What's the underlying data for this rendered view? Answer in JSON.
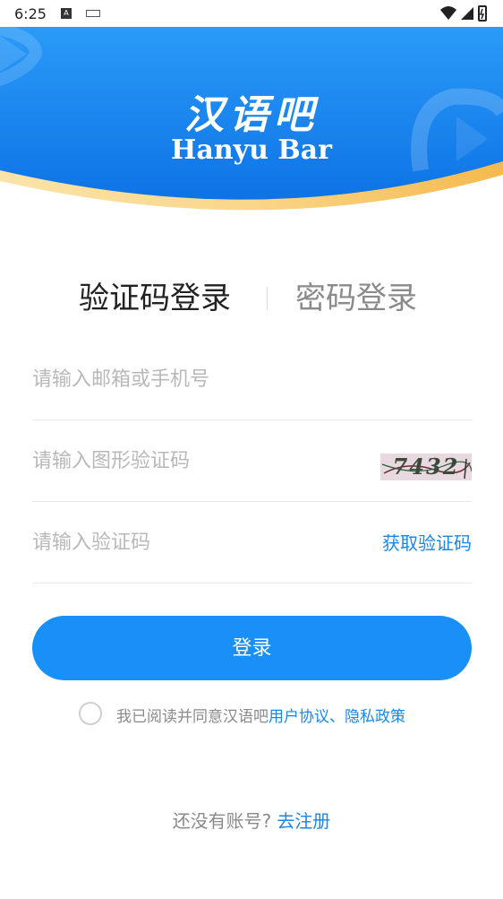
{
  "status_bar": {
    "time": "6:25"
  },
  "header": {
    "brand_cn": "汉语吧",
    "brand_en": "Hanyu Bar",
    "colors": {
      "blue_top": "#1e8ff5",
      "blue_bottom": "#1277e8",
      "gold": "#f8c96a"
    }
  },
  "tabs": {
    "active_label": "验证码登录",
    "inactive_label": "密码登录"
  },
  "fields": {
    "email_placeholder": "请输入邮箱或手机号",
    "captcha_placeholder": "请输入图形验证码",
    "captcha_image_text": "7432",
    "code_placeholder": "请输入验证码",
    "get_code_label": "获取验证码"
  },
  "login_button": {
    "label": "登录",
    "color": "#1890f7"
  },
  "agreement": {
    "prefix": "我已阅读并同意汉语吧",
    "user_agreement": "用户协议",
    "separator": "、",
    "privacy_policy": "隐私政策",
    "link_color": "#1a86e6"
  },
  "register": {
    "question": "还没有账号?",
    "link": "去注册"
  }
}
